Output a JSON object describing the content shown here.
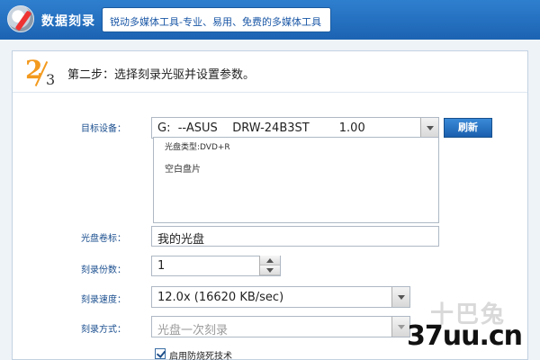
{
  "app": {
    "title": "数据刻录",
    "slogan": "锐动多媒体工具-专业、易用、免费的多媒体工具"
  },
  "step": {
    "numerator": "2",
    "denominator": "3",
    "text": "第二步：选择刻录光驱并设置参数。"
  },
  "form": {
    "device_label": "目标设备：",
    "device_value": "G:  --ASUS    DRW-24B3ST        1.00",
    "disc_type": "光盘类型:DVD+R",
    "disc_status": "空白盘片",
    "refresh_label": "刷新",
    "volume_label": "光盘卷标：",
    "volume_value": "我的光盘",
    "copies_label": "刻录份数：",
    "copies_value": "1",
    "speed_label": "刻录速度：",
    "speed_value": "12.0x (16620 KB/sec)",
    "mode_label": "刻录方式：",
    "mode_value": "光盘一次刻录",
    "burnproof_label": "启用防烧死技术",
    "burnproof_checked": true
  },
  "watermark": {
    "cn": "十巴兔",
    "site": "37uu.cn"
  },
  "colors": {
    "header": "#1f68b8",
    "accent_orange": "#f39a1e",
    "label_blue": "#1b4f8f"
  }
}
